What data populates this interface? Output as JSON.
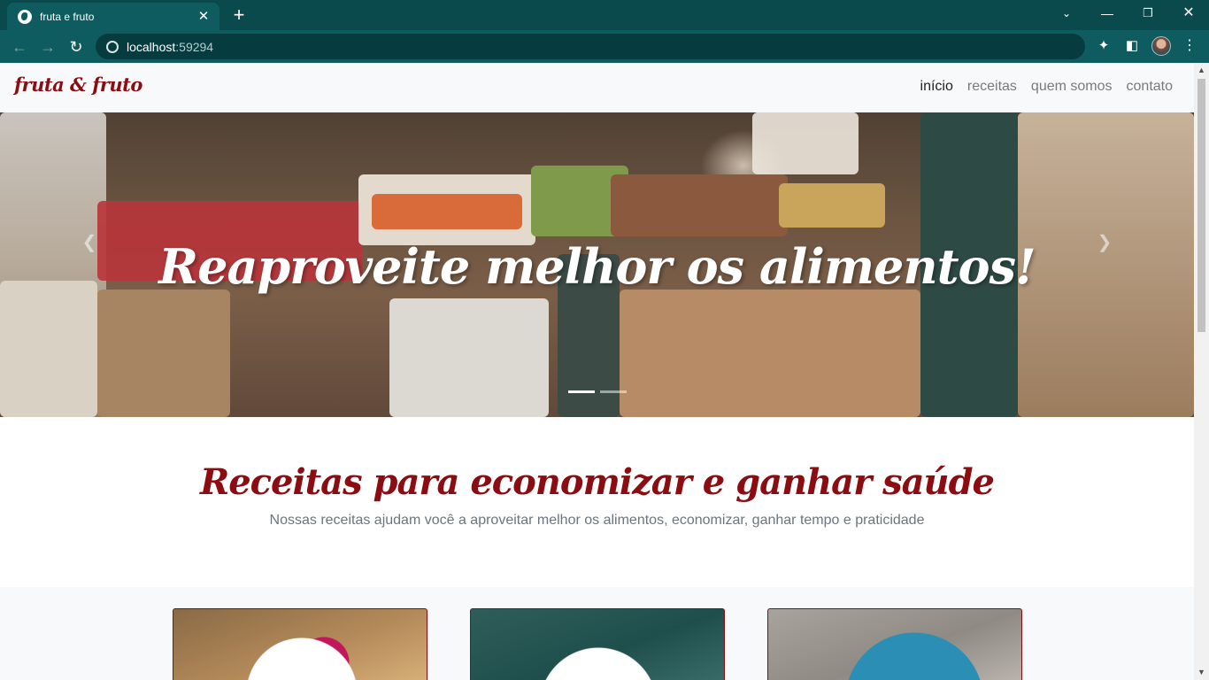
{
  "browser": {
    "tab_title": "fruta e fruto",
    "url_host": "localhost",
    "url_port": ":59294"
  },
  "site": {
    "brand": "fruta & fruto",
    "nav": [
      {
        "label": "início",
        "active": true
      },
      {
        "label": "receitas",
        "active": false
      },
      {
        "label": "quem somos",
        "active": false
      },
      {
        "label": "contato",
        "active": false
      }
    ]
  },
  "hero": {
    "caption": "Reaproveite melhor os alimentos!",
    "slide_count": 2,
    "active_slide": 1
  },
  "intro": {
    "heading": "Receitas para economizar e ganhar saúde",
    "subheading": "Nossas receitas ajudam você a aproveitar melhor os alimentos, economizar, ganhar tempo e praticidade"
  },
  "colors": {
    "brand": "#8b0d12",
    "browser_frame": "#0a4a4d",
    "browser_toolbar": "#0e5c5f",
    "navbar_bg": "#f8f9fa",
    "muted_text": "#6c757d"
  }
}
